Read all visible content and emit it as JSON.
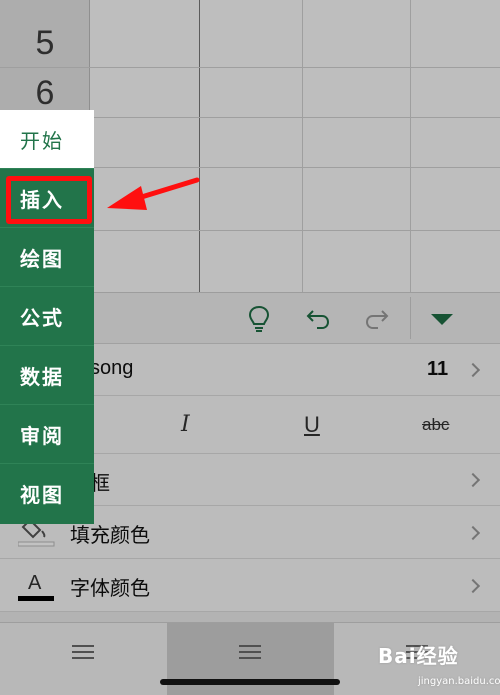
{
  "spreadsheet": {
    "row_numbers": [
      "5",
      "6"
    ]
  },
  "side_menu": {
    "items": [
      {
        "label": "开始",
        "active": true
      },
      {
        "label": "插入",
        "active": false,
        "highlighted": true
      },
      {
        "label": "绘图",
        "active": false
      },
      {
        "label": "公式",
        "active": false
      },
      {
        "label": "数据",
        "active": false
      },
      {
        "label": "审阅",
        "active": false
      },
      {
        "label": "视图",
        "active": false
      }
    ]
  },
  "toolbar": {
    "icons": [
      "lightbulb-icon",
      "undo-icon",
      "redo-icon",
      "collapse-triangle-icon"
    ]
  },
  "panel": {
    "font_name": "song",
    "font_size": "11",
    "format_buttons": {
      "italic": "I",
      "underline": "U",
      "strikethrough": "abc"
    },
    "border_label": "框",
    "fill_color_label": "填充颜色",
    "font_color_label": "字体颜色"
  },
  "watermark": {
    "logo": "Bai经验",
    "url": "jingyan.baidu.com"
  },
  "colors": {
    "accent_green": "#22744a",
    "highlight_red": "#ff0f0f"
  }
}
